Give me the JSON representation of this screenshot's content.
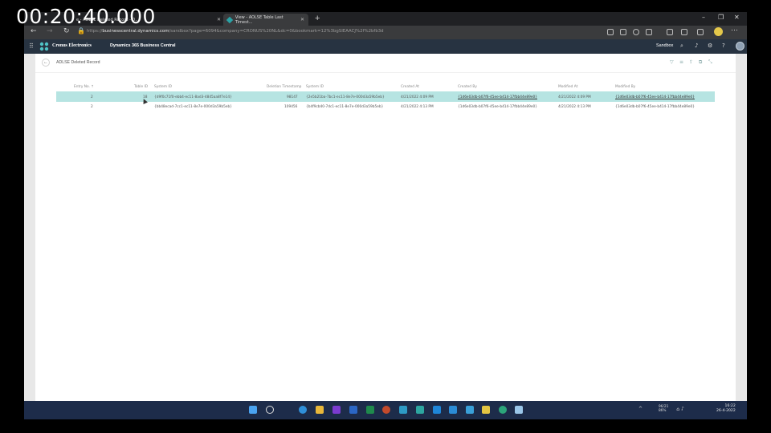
{
  "overlay": {
    "timestamp": "00:20:40.000"
  },
  "browser": {
    "tabs": [
      {
        "label": "e - AOLSE Deleted Record - D..."
      },
      {
        "label": "View - AOLSE Table Last Timest..."
      }
    ],
    "new_tab": "+",
    "window_controls": {
      "minimize": "–",
      "restore": "❐",
      "close": "✕"
    },
    "url_prefix": "https://",
    "url_host": "businesscentral.dynamics.com",
    "url_rest": "/sandbox?page=6094&company=CRONUS%20NL&dc=0&bookmark=12%3bgSIEAACJ%2f%2bfb3d"
  },
  "bc": {
    "company_name": "Cronus Electronics",
    "product_name": "Dynamics 365 Business Central",
    "environment": "Sandbox",
    "page_title": "ADLSE Deleted Record",
    "columns": [
      "Entry No. ↑",
      "Table ID",
      "System ID",
      "Deletion Timestamp",
      "System ID",
      "Created At",
      "Created By",
      "Modified At",
      "Modified By"
    ],
    "rows": [
      [
        "2",
        "18",
        "{d9f0c71f0-ebb4-ec11-8ad3-4845aa8f7e14}",
        "98147",
        "{2e5b21ba-7bc1-ec11-8e7e-000d3a59b5eb}",
        "4/21/2022 4:09 PM",
        "{1d6e03db-b07f6-45ee-b414-17fbb44e89e0}",
        "4/21/2022 4:09 PM",
        "{1d6e03db-b07f6-45ee-b414-17fbb44e89e0}"
      ],
      [
        "2",
        "",
        "{bb48ecad-7cc1-ec11-8e7e-000d3a59b5eb}",
        "109456",
        "{b4f9cb40-7dc1-ec11-8e7e-000d3a59b5eb}",
        "4/21/2022 4:13 PM",
        "{1d6e03db-b07f6-45ee-b414-17fbb44e89e0}",
        "4/21/2022 4:13 PM",
        "{1d6e03db-b07f6-45ee-b414-17fbb44e89e0}"
      ]
    ]
  },
  "taskbar": {
    "tray_text": "^",
    "temperature": "96/21",
    "battery": "86%",
    "time": "16:22",
    "date": "26-4-2022"
  },
  "colors": {
    "accent": "#2aa3a6",
    "header": "#273341",
    "row_highlight": "#b6e4e2",
    "taskbar": "#1d2c4a"
  }
}
